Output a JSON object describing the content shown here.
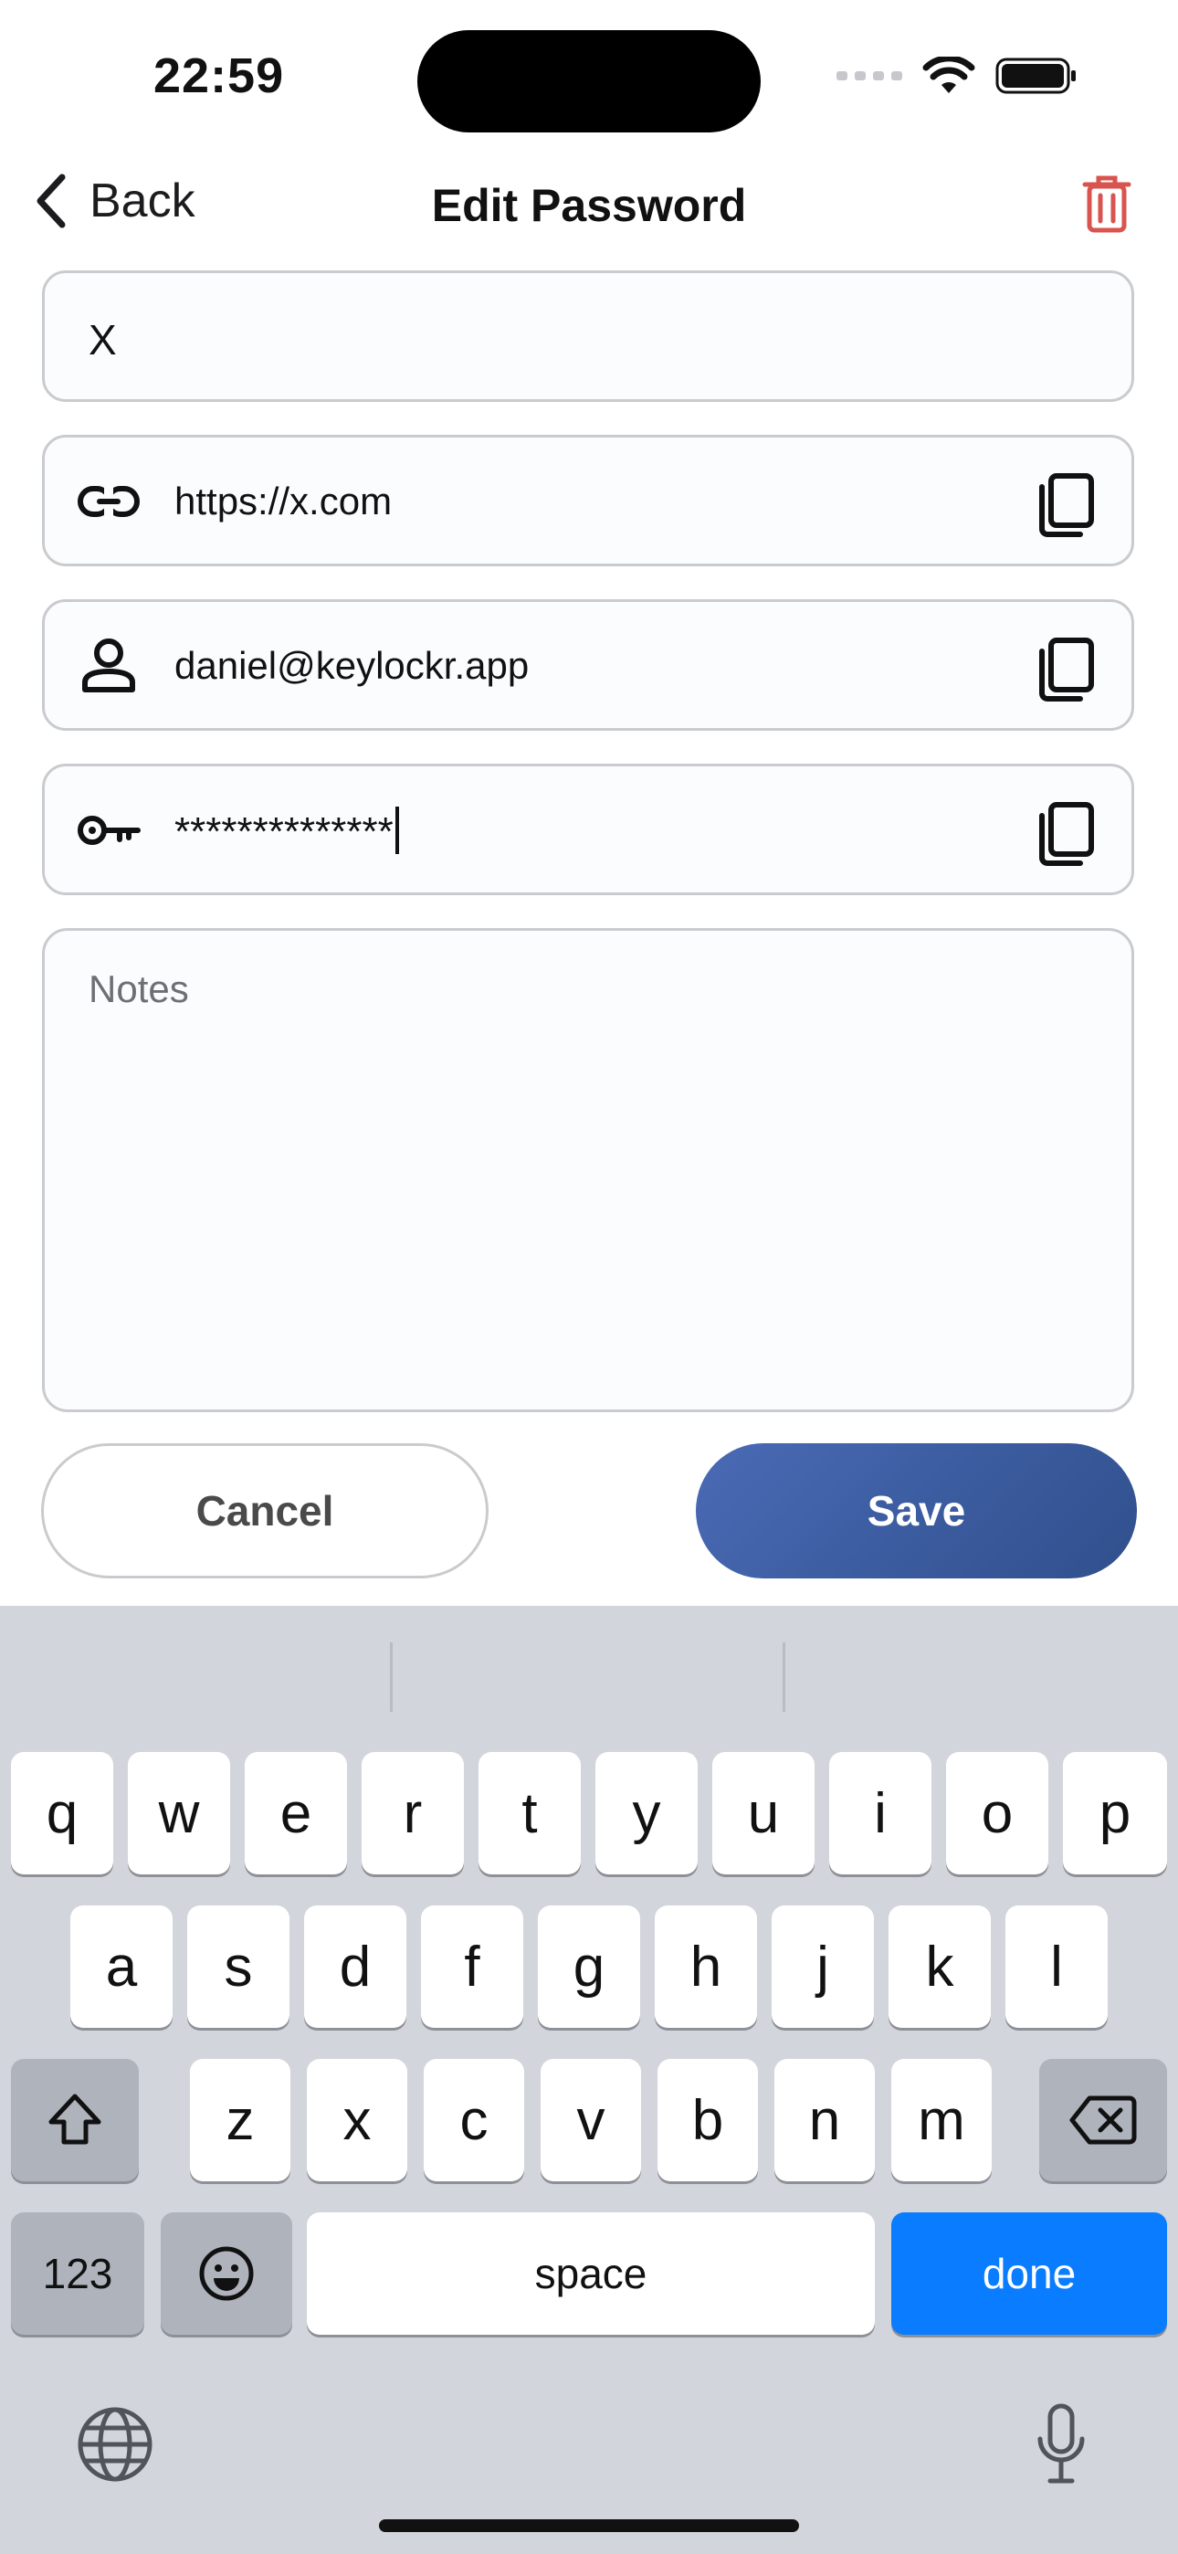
{
  "status_bar": {
    "time": "22:59"
  },
  "nav": {
    "back_label": "Back",
    "title": "Edit Password"
  },
  "form": {
    "title_value": "X",
    "url_value": "https://x.com",
    "username_value": "daniel@keylockr.app",
    "password_masked": "**************",
    "notes_placeholder": "Notes"
  },
  "buttons": {
    "cancel": "Cancel",
    "save": "Save"
  },
  "keyboard": {
    "row1": [
      "q",
      "w",
      "e",
      "r",
      "t",
      "y",
      "u",
      "i",
      "o",
      "p"
    ],
    "row2": [
      "a",
      "s",
      "d",
      "f",
      "g",
      "h",
      "j",
      "k",
      "l"
    ],
    "row3": [
      "z",
      "x",
      "c",
      "v",
      "b",
      "n",
      "m"
    ],
    "numbers_label": "123",
    "space_label": "space",
    "done_label": "done"
  },
  "colors": {
    "accent": "#0a7cff",
    "delete": "#d9534f",
    "save_gradient_start": "#4a6ab6",
    "save_gradient_end": "#2f4f8c"
  },
  "icons": [
    "back-chevron-icon",
    "trash-icon",
    "link-icon",
    "person-icon",
    "key-icon",
    "copy-icon",
    "shift-icon",
    "backspace-icon",
    "emoji-icon",
    "globe-icon",
    "microphone-icon"
  ]
}
